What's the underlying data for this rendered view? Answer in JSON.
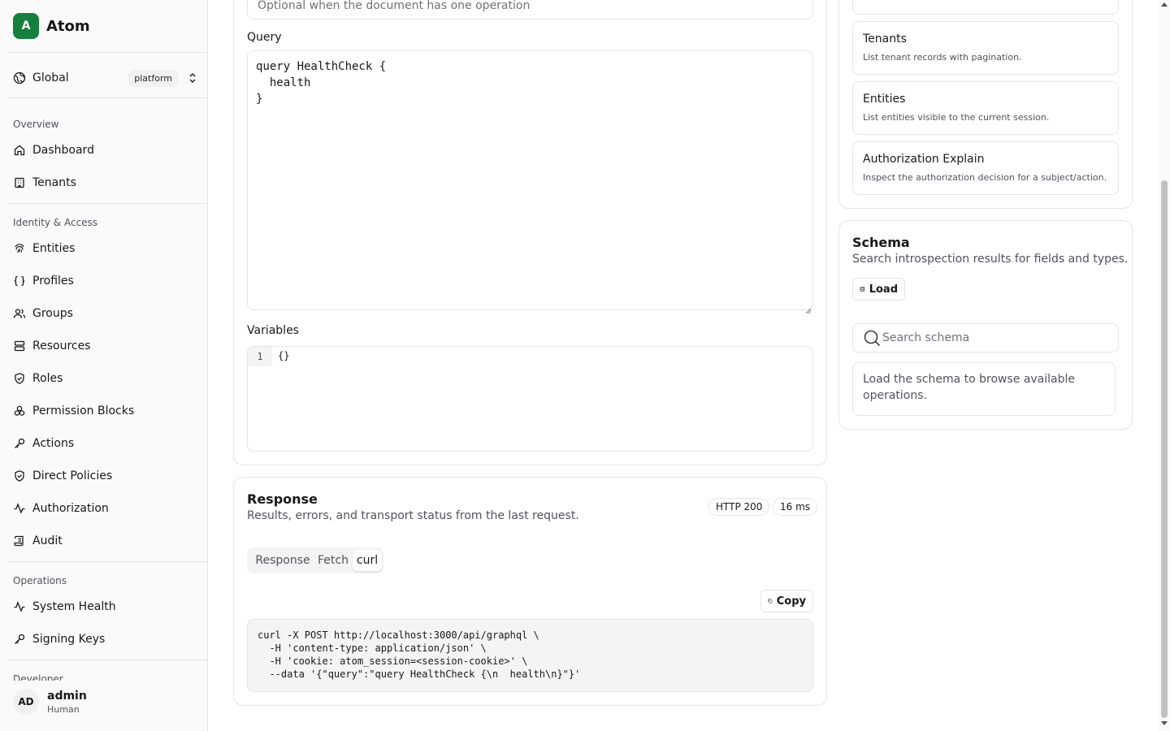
{
  "app": {
    "logo_letter": "A",
    "name": "Atom"
  },
  "scope": {
    "name": "Global",
    "badge": "platform"
  },
  "nav": {
    "sections": [
      {
        "title": "Overview",
        "items": [
          "Dashboard",
          "Tenants"
        ]
      },
      {
        "title": "Identity & Access",
        "items": [
          "Entities",
          "Profiles",
          "Groups",
          "Resources",
          "Roles",
          "Permission Blocks",
          "Actions",
          "Direct Policies",
          "Authorization",
          "Audit"
        ]
      },
      {
        "title": "Operations",
        "items": [
          "System Health",
          "Signing Keys"
        ]
      },
      {
        "title": "Developer",
        "items": []
      }
    ]
  },
  "user": {
    "initials": "AD",
    "name": "admin",
    "role": "Human"
  },
  "request": {
    "operation_placeholder": "Optional when the document has one operation",
    "query_label": "Query",
    "query_text": "query HealthCheck {\n  health\n}",
    "variables_label": "Variables",
    "variables_line": "1",
    "variables_text": "{}"
  },
  "response": {
    "title": "Response",
    "subtitle": "Results, errors, and transport status from the last request.",
    "status": "HTTP 200",
    "timing": "16 ms",
    "tabs": [
      "Response",
      "Fetch",
      "curl"
    ],
    "active_tab": "curl",
    "copy_label": "Copy",
    "curl_text": "curl -X POST http://localhost:3000/api/graphql \\\n  -H 'content-type: application/json' \\\n  -H 'cookie: atom_session=<session-cookie>' \\\n  --data '{\"query\":\"query HealthCheck {\\n  health\\n}\"}'"
  },
  "operations": {
    "items": [
      {
        "name": "Tenants",
        "description": "List tenant records with pagination."
      },
      {
        "name": "Entities",
        "description": "List entities visible to the current session."
      },
      {
        "name": "Authorization Explain",
        "description": "Inspect the authorization decision for a subject/action."
      }
    ]
  },
  "schema": {
    "title": "Schema",
    "subtitle": "Search introspection results for fields and types.",
    "load_label": "Load",
    "search_placeholder": "Search schema",
    "empty_text": "Load the schema to browse available operations."
  },
  "colors": {
    "brand": "#15803d",
    "border": "#e4e4e7",
    "muted": "#52525b"
  }
}
